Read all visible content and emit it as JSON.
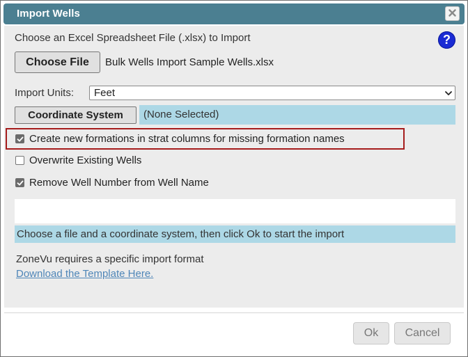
{
  "dialog": {
    "title": "Import Wells",
    "close_symbol": "✖",
    "help_symbol": "?"
  },
  "file": {
    "prompt": "Choose an Excel Spreadsheet File (.xlsx) to Import",
    "button_label": "Choose File",
    "selected_name": "Bulk Wells Import Sample Wells.xlsx"
  },
  "units": {
    "label": "Import Units:",
    "selected": "Feet"
  },
  "coordinate": {
    "button_label": "Coordinate System",
    "value": "(None Selected)"
  },
  "options": [
    {
      "label": "Create new formations in strat columns for missing formation names",
      "checked": true
    },
    {
      "label": "Overwrite Existing Wells",
      "checked": false
    },
    {
      "label": "Remove Well Number from Well Name",
      "checked": true
    }
  ],
  "status": {
    "message": "Choose a file and a coordinate system, then click Ok to start the import"
  },
  "info": {
    "text": "ZoneVu requires a specific import format",
    "link": "Download the Template Here."
  },
  "footer": {
    "ok_label": "Ok",
    "cancel_label": "Cancel"
  },
  "colors": {
    "titlebar": "#4b7f91",
    "highlight_border": "#a51c1c",
    "info_fill": "#add8e6",
    "help_icon": "#1a2bd4",
    "link": "#4f86b8"
  },
  "icons": {
    "close": "close-icon",
    "help": "help-icon",
    "dropdown": "chevron-down-icon",
    "check": "check-icon"
  }
}
